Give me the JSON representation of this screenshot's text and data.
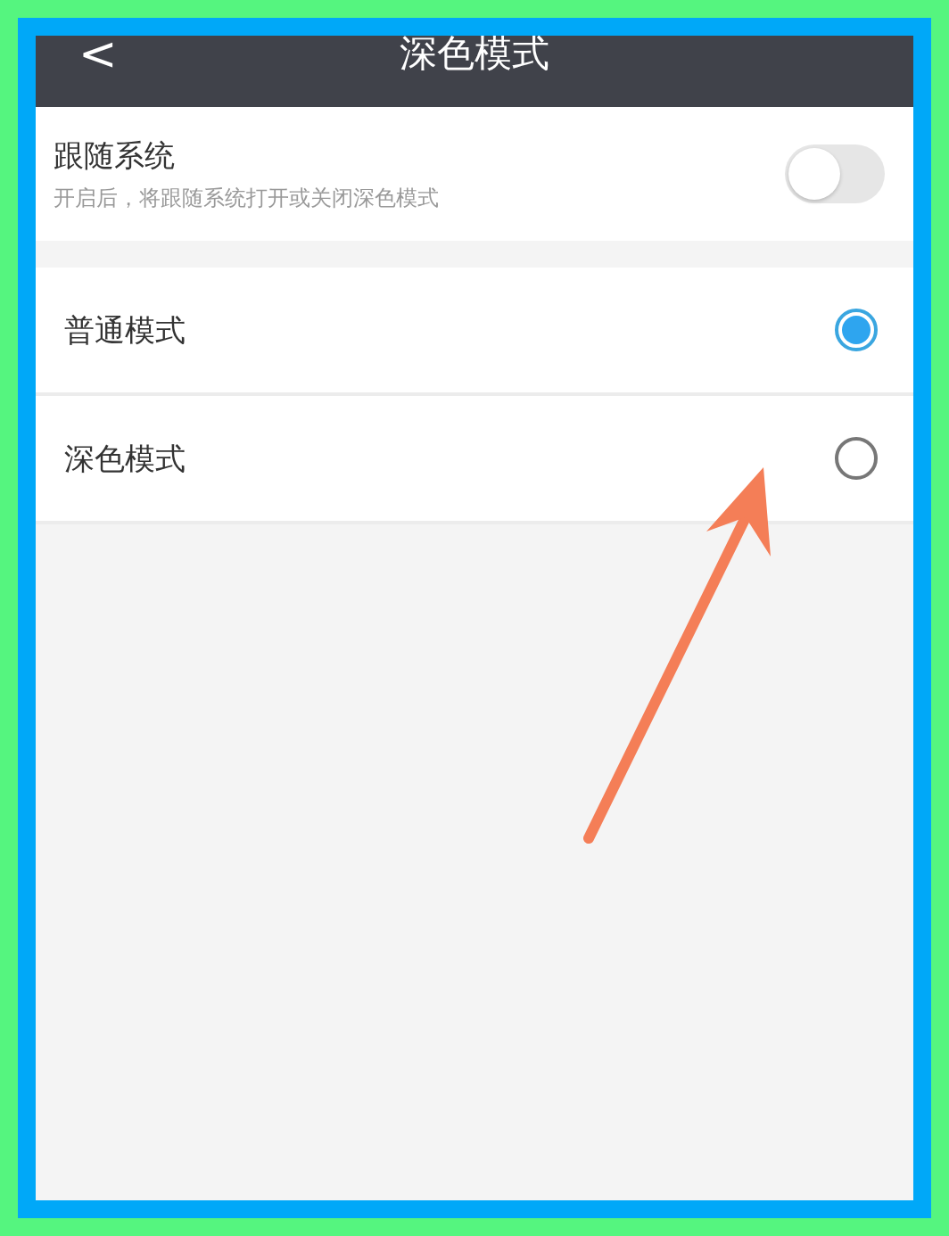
{
  "header": {
    "back": "<",
    "title": "深色模式"
  },
  "follow_system": {
    "label": "跟随系统",
    "description": "开启后，将跟随系统打开或关闭深色模式",
    "on": false
  },
  "modes": [
    {
      "label": "普通模式",
      "selected": true
    },
    {
      "label": "深色模式",
      "selected": false
    }
  ]
}
